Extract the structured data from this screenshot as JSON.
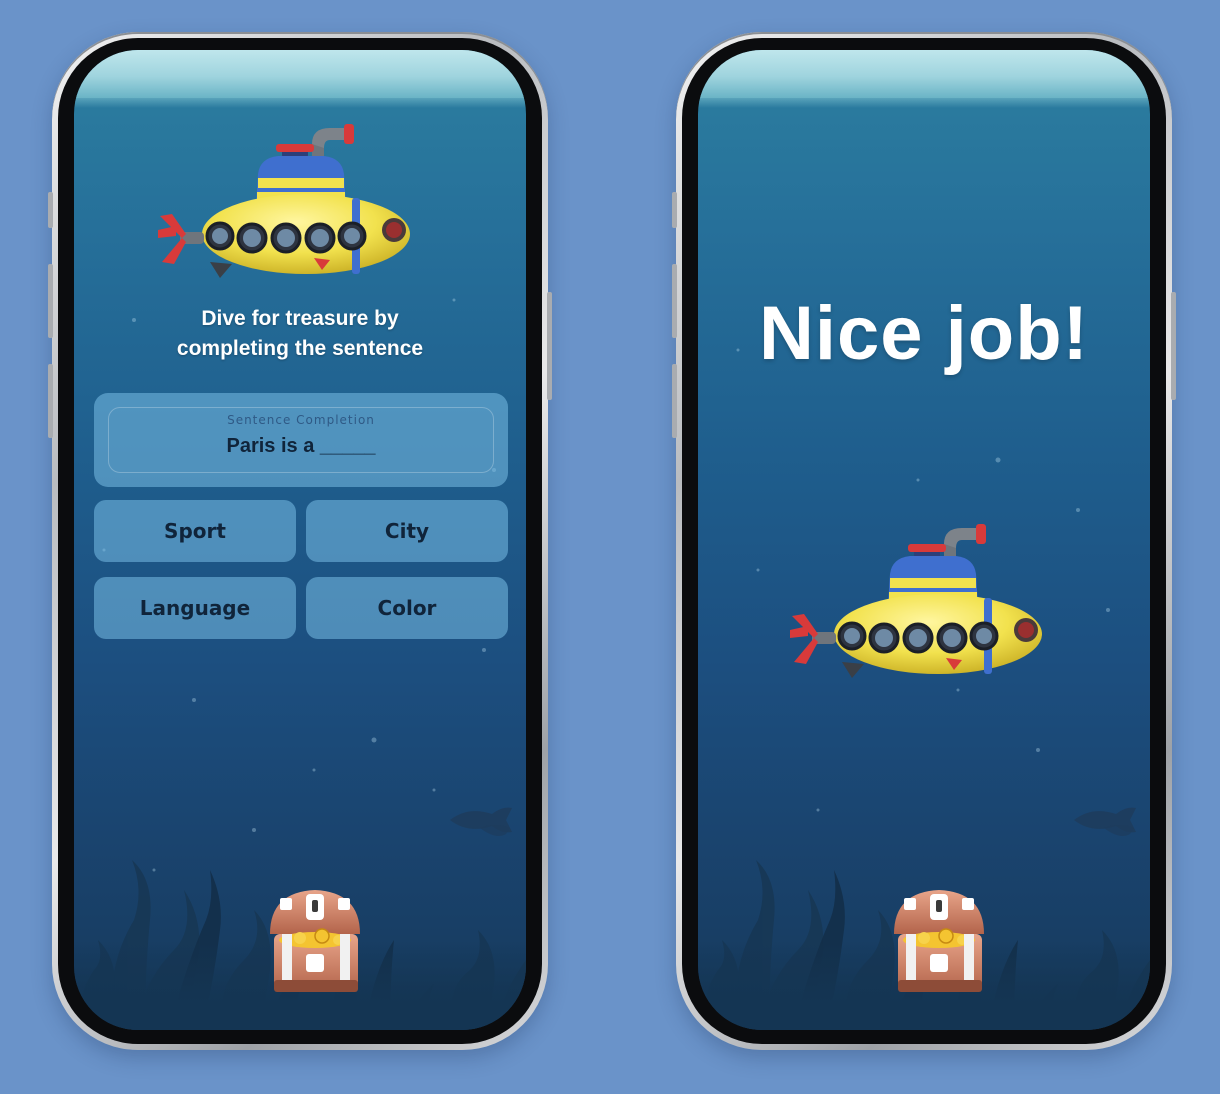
{
  "left_phone": {
    "prompt_line1": "Dive for treasure by",
    "prompt_line2": "completing the sentence",
    "question": {
      "label": "Sentence Completion",
      "sentence": "Paris is a _____"
    },
    "options": [
      {
        "label": "Sport"
      },
      {
        "label": "City"
      },
      {
        "label": "Language"
      },
      {
        "label": "Color"
      }
    ]
  },
  "right_phone": {
    "message": "Nice job!"
  },
  "colors": {
    "background": "#6a93c9",
    "water_top": "#2c7fa0",
    "water_bottom": "#16395b",
    "card": "rgba(120,190,230,0.55)",
    "submarine": "#f2e24e",
    "submarine_stripe": "#3f6fcf"
  },
  "icons": {
    "submarine": "submarine-icon",
    "treasure_chest": "treasure-chest-icon",
    "fish": "fish-icon",
    "seaweed": "seaweed-icon"
  }
}
